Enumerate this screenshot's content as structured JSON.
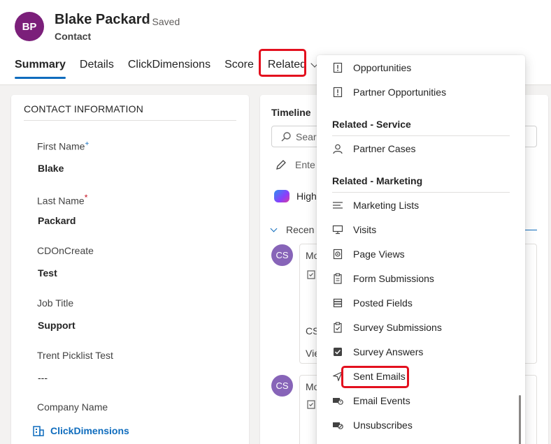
{
  "record": {
    "initials": "BP",
    "name": "Blake Packard",
    "saved": "- Saved",
    "entity": "Contact"
  },
  "tabs": [
    {
      "label": "Summary"
    },
    {
      "label": "Details"
    },
    {
      "label": "ClickDimensions"
    },
    {
      "label": "Score"
    },
    {
      "label": "Related"
    }
  ],
  "contact_info": {
    "title": "CONTACT INFORMATION",
    "fields": [
      {
        "label": "First Name",
        "req": "+",
        "value": "Blake"
      },
      {
        "label": "Last Name",
        "req": "*",
        "value": "Packard"
      },
      {
        "label": "CDOnCreate",
        "value": "Test"
      },
      {
        "label": "Job Title",
        "value": "Support"
      },
      {
        "label": "Trent Picklist Test",
        "value": "---"
      },
      {
        "label": "Company Name",
        "value": "ClickDimensions"
      }
    ]
  },
  "timeline": {
    "title": "Timeline",
    "search": "Searc",
    "note": "Ente",
    "highlights": "High",
    "recent": "Recen",
    "avatar": "CS",
    "act1_line1": "Mo",
    "act1_cs": "CS",
    "act1_view": "Vie",
    "act2_line1": "Mo"
  },
  "dropdown": {
    "top_items": [
      "Opportunities",
      "Partner Opportunities"
    ],
    "service_header": "Related - Service",
    "service_items": [
      "Partner Cases"
    ],
    "marketing_header": "Related - Marketing",
    "marketing_items": [
      "Marketing Lists",
      "Visits",
      "Page Views",
      "Form Submissions",
      "Posted Fields",
      "Survey Submissions",
      "Survey Answers",
      "Sent Emails",
      "Email Events",
      "Unsubscribes"
    ]
  },
  "colors": {
    "accent": "#0f6cbd",
    "avatar_bg": "#7b1f7a",
    "highlight_red": "#e3101e"
  }
}
